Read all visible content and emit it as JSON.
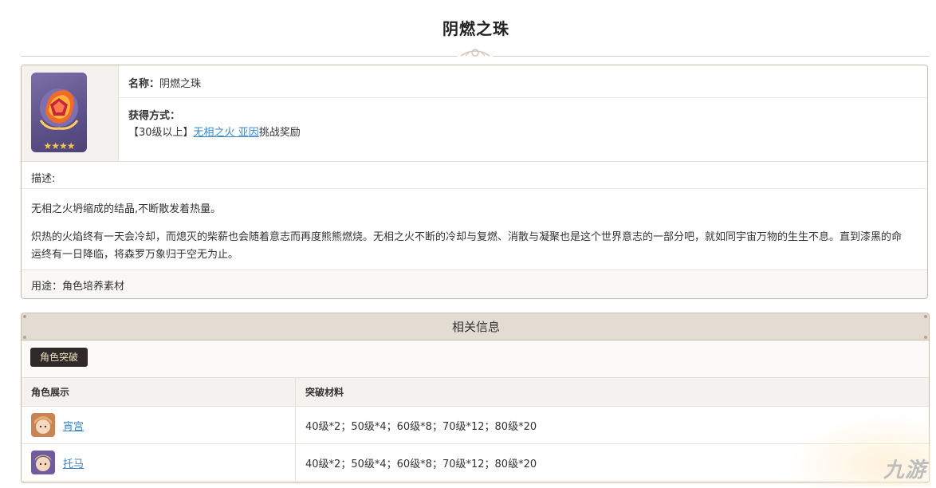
{
  "page": {
    "title": "阴燃之珠"
  },
  "item": {
    "name_label": "名称：",
    "name_value": "阴燃之珠",
    "stars": "★★★★",
    "obtain_label": "获得方式：",
    "obtain_prefix": "【30级以上】",
    "obtain_link": "无相之火 亚因",
    "obtain_suffix": "挑战奖励",
    "desc_label": "描述:",
    "desc_short": "无相之火坍缩成的结晶,不断散发着热量。",
    "desc_long": "炽热的火焰终有一天会冷却，而熄灭的柴薪也会随着意志而再度熊熊燃烧。无相之火不断的冷却与复燃、消散与凝聚也是这个世界意志的一部分吧，就如同宇宙万物的生生不息。直到漆黑的命运终有一日降临，将森罗万象归于空无为止。",
    "usage": "用途：角色培养素材"
  },
  "related": {
    "header": "相关信息",
    "tab": "角色突破",
    "columns": [
      "角色展示",
      "突破材料"
    ],
    "rows": [
      {
        "name": "宵宫",
        "materials": "40级*2；50级*4；60级*8；70级*12；80级*20"
      },
      {
        "name": "托马",
        "materials": "40级*2；50级*4；60级*8；70级*12；80级*20"
      }
    ]
  },
  "watermark": {
    "text": "九游"
  },
  "colors": {
    "link": "#3a87c8",
    "border": "#cdbba6",
    "header_bg": "#e3dcd3",
    "tab_bg": "#2f2a27"
  }
}
